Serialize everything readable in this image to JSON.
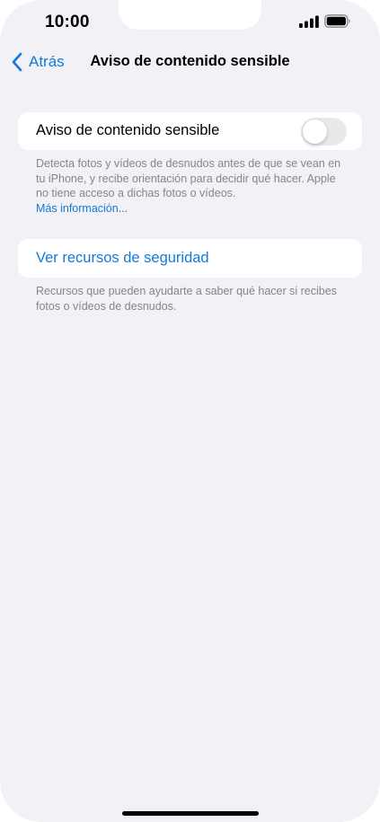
{
  "status_bar": {
    "time": "10:00"
  },
  "nav": {
    "back_label": "Atrás",
    "title": "Aviso de contenido sensible"
  },
  "toggle_section": {
    "label": "Aviso de contenido sensible",
    "enabled": false,
    "footnote": "Detecta fotos y vídeos de desnudos antes de que se vean en tu iPhone, y recibe orientación para decidir qué hacer. Apple no tiene acceso a dichas fotos o vídeos.",
    "more_link": "Más información..."
  },
  "resources_section": {
    "link_label": "Ver recursos de seguridad",
    "footnote": "Recursos que pueden ayudarte a saber qué hacer si recibes fotos o vídeos de desnudos."
  },
  "colors": {
    "background": "#f2f1f6",
    "accent": "#1279d6",
    "footnote": "#85858a",
    "toggle_off": "#e9e9eb"
  },
  "icons": {
    "back": "chevron-left-icon",
    "signal": "cellular-signal-icon",
    "battery": "battery-icon"
  }
}
